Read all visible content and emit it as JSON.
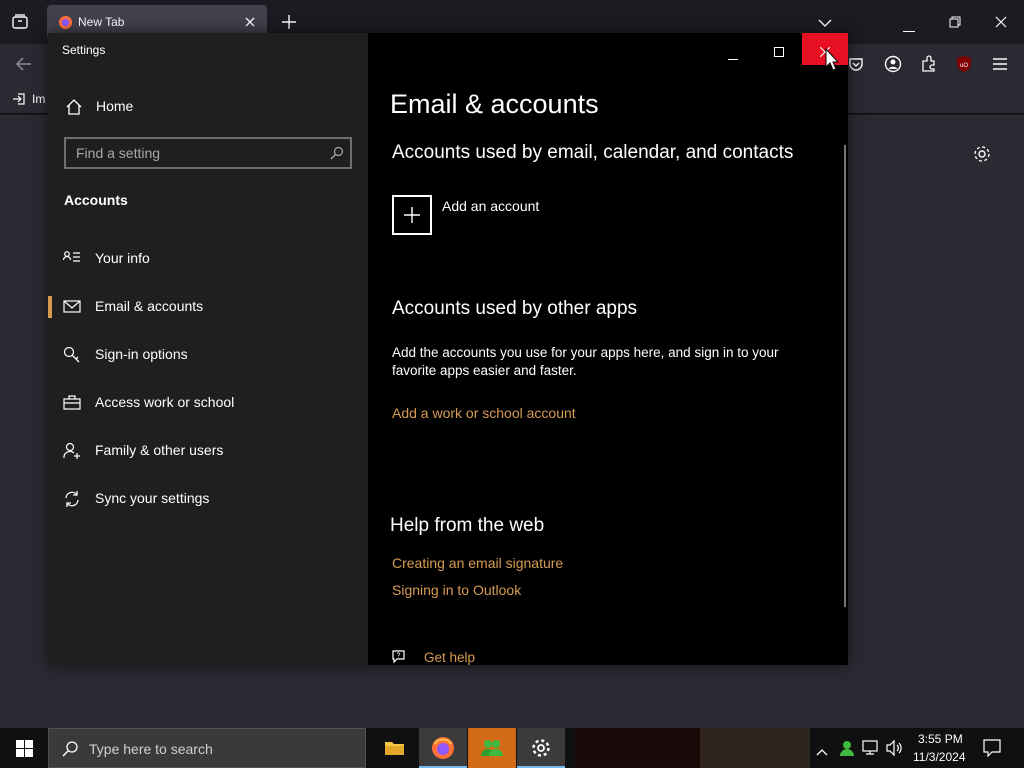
{
  "browser": {
    "tab_title": "New Tab",
    "bookmark_label": "Im"
  },
  "settings": {
    "window_title": "Settings",
    "sidebar": {
      "home_label": "Home",
      "search_placeholder": "Find a setting",
      "section_label": "Accounts",
      "items": [
        {
          "label": "Your info",
          "icon": "person-card-icon"
        },
        {
          "label": "Email & accounts",
          "icon": "mail-icon",
          "selected": true
        },
        {
          "label": "Sign-in options",
          "icon": "key-icon"
        },
        {
          "label": "Access work or school",
          "icon": "briefcase-icon"
        },
        {
          "label": "Family & other users",
          "icon": "person-add-icon"
        },
        {
          "label": "Sync your settings",
          "icon": "sync-icon"
        }
      ]
    },
    "main": {
      "page_title": "Email & accounts",
      "section1_heading": "Accounts used by email, calendar, and contacts",
      "add_account_label": "Add an account",
      "section2_heading": "Accounts used by other apps",
      "section2_desc": "Add the accounts you use for your apps here, and sign in to your favorite apps easier and faster.",
      "add_work_link": "Add a work or school account",
      "help_heading": "Help from the web",
      "help_links": [
        "Creating an email signature",
        "Signing in to Outlook"
      ],
      "get_help_label": "Get help"
    }
  },
  "taskbar": {
    "search_placeholder": "Type here to search",
    "time": "3:55 PM",
    "date": "11/3/2024"
  },
  "colors": {
    "accent": "#d69b52",
    "close_button": "#e81123",
    "sidebar_bg": "#1f1f1f"
  }
}
